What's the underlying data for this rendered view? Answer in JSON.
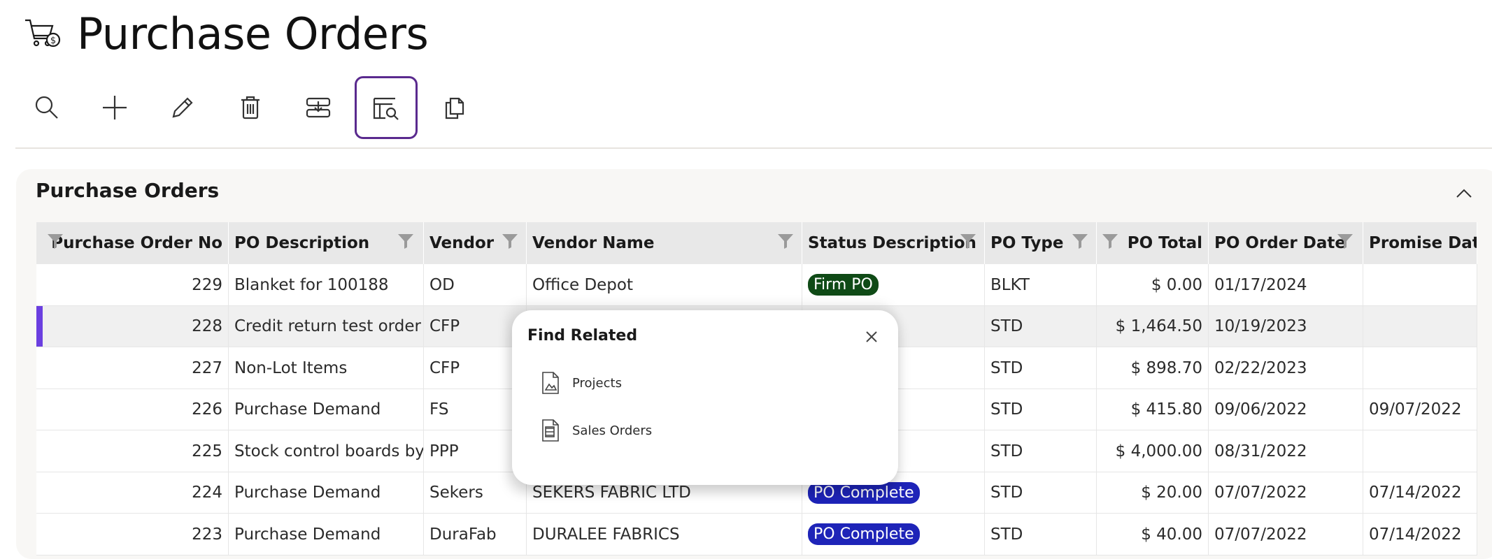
{
  "page": {
    "title": "Purchase Orders"
  },
  "toolbar": {
    "buttons": [
      {
        "name": "search-button",
        "icon": "search-icon"
      },
      {
        "name": "add-button",
        "icon": "plus-icon"
      },
      {
        "name": "edit-button",
        "icon": "pencil-icon"
      },
      {
        "name": "delete-button",
        "icon": "trash-icon"
      },
      {
        "name": "import-button",
        "icon": "download-tray-icon"
      },
      {
        "name": "find-related-button",
        "icon": "table-search-icon",
        "active": true
      },
      {
        "name": "copy-button",
        "icon": "copy-icon"
      }
    ],
    "active_border_color": "#5a2a8e"
  },
  "panel": {
    "title": "Purchase Orders"
  },
  "table": {
    "columns": [
      "Purchase Order No",
      "PO Description",
      "Vendor",
      "Vendor Name",
      "Status Description",
      "PO Type",
      "PO Total",
      "PO Order Date",
      "Promise Date"
    ],
    "rows": [
      {
        "po_no": "229",
        "desc": "Blanket for 100188",
        "vendor": "OD",
        "vendor_name": "Office Depot",
        "status": "Firm PO",
        "type": "BLKT",
        "total": "$ 0.00",
        "order_date": "01/17/2024",
        "promise_date": ""
      },
      {
        "po_no": "228",
        "desc": "Credit return test order",
        "vendor": "CFP",
        "vendor_name": "",
        "status": "",
        "type": "STD",
        "total": "$ 1,464.50",
        "order_date": "10/19/2023",
        "promise_date": ""
      },
      {
        "po_no": "227",
        "desc": "Non-Lot Items",
        "vendor": "CFP",
        "vendor_name": "",
        "status": "",
        "type": "STD",
        "total": "$ 898.70",
        "order_date": "02/22/2023",
        "promise_date": ""
      },
      {
        "po_no": "226",
        "desc": "Purchase Demand",
        "vendor": "FS",
        "vendor_name": "",
        "status": "",
        "type": "STD",
        "total": "$ 415.80",
        "order_date": "09/06/2022",
        "promise_date": "09/07/2022"
      },
      {
        "po_no": "225",
        "desc": "Stock control boards by lot",
        "vendor": "PPP",
        "vendor_name": "",
        "status": "",
        "type": "STD",
        "total": "$ 4,000.00",
        "order_date": "08/31/2022",
        "promise_date": ""
      },
      {
        "po_no": "224",
        "desc": "Purchase Demand",
        "vendor": "Sekers",
        "vendor_name": "SEKERS FABRIC LTD",
        "status": "PO Complete",
        "type": "STD",
        "total": "$ 20.00",
        "order_date": "07/07/2022",
        "promise_date": "07/14/2022"
      },
      {
        "po_no": "223",
        "desc": "Purchase Demand",
        "vendor": "DuraFab",
        "vendor_name": "DURALEE FABRICS",
        "status": "PO Complete",
        "type": "STD",
        "total": "$ 40.00",
        "order_date": "07/07/2022",
        "promise_date": "07/14/2022"
      }
    ]
  },
  "popup": {
    "title": "Find Related",
    "items": [
      {
        "label": "Projects",
        "icon": "document-image-icon"
      },
      {
        "label": "Sales Orders",
        "icon": "document-list-icon"
      }
    ]
  },
  "colors": {
    "firm_badge": "#0f4a16",
    "complete_badge": "#1e24b8",
    "selected_row_accent": "#6b3fe0"
  }
}
